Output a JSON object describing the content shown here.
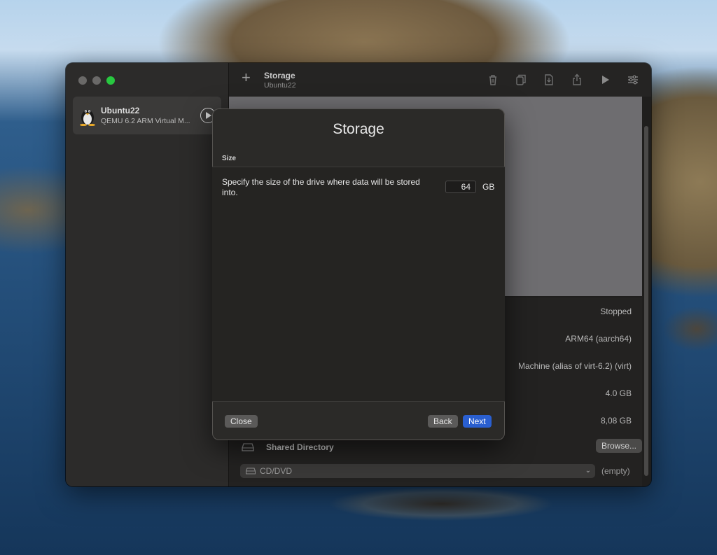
{
  "sidebar": {
    "vm": {
      "name": "Ubuntu22",
      "subtitle": "QEMU 6.2 ARM Virtual M...",
      "icon": "tux-icon"
    }
  },
  "toolbar": {
    "title": "Storage",
    "subtitle": "Ubuntu22",
    "add_icon": "+",
    "icons": [
      "trash-icon",
      "clone-icon",
      "download-icon",
      "share-icon",
      "play-icon",
      "settings-sliders-icon"
    ]
  },
  "details": {
    "status": "Stopped",
    "architecture": "ARM64 (aarch64)",
    "machine": "Machine (alias of virt-6.2) (virt)",
    "memory": "4.0 GB",
    "size": "8,08 GB",
    "shared_directory_label": "Shared Directory",
    "browse_label": "Browse...",
    "cd_label": "CD/DVD",
    "cd_status": "(empty)"
  },
  "dialog": {
    "title": "Storage",
    "section": "Size",
    "description": "Specify the size of the drive where data will be stored into.",
    "size_value": "64",
    "unit": "GB",
    "close_label": "Close",
    "back_label": "Back",
    "next_label": "Next"
  },
  "colors": {
    "accent": "#2a5fd0",
    "window_bg": "#1f1e1d",
    "sidebar_bg": "#2c2b2a",
    "maximize": "#28c840"
  }
}
